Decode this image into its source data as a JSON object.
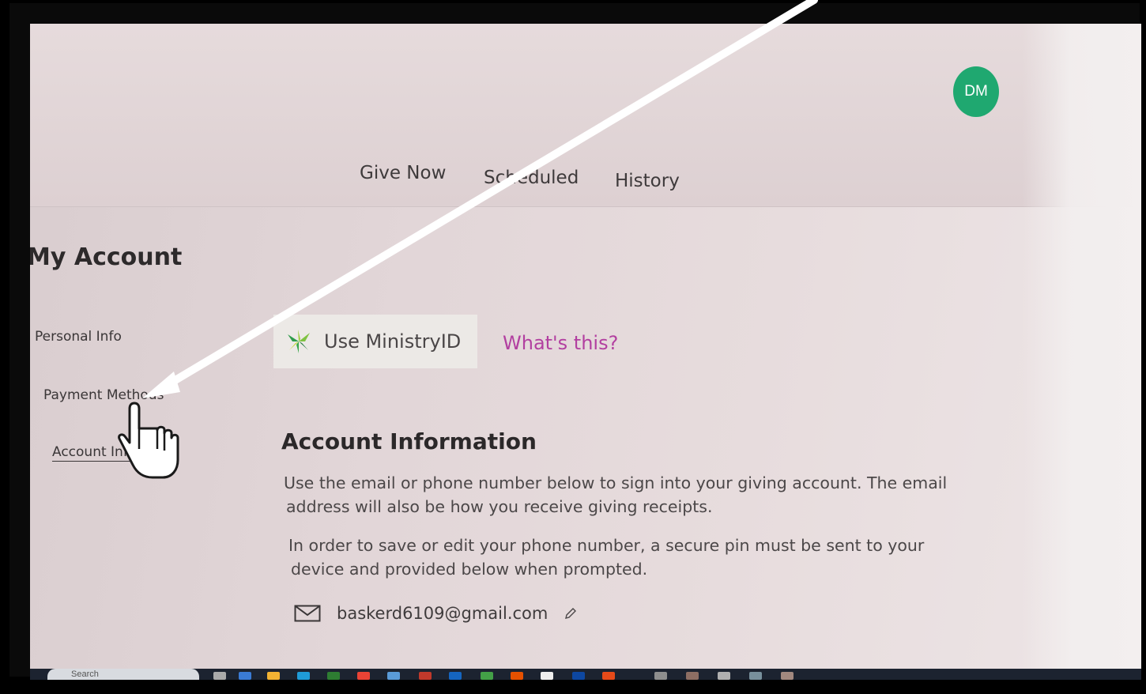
{
  "header": {
    "avatar_initials": "DM",
    "nav": [
      {
        "label": "Give Now"
      },
      {
        "label": "Scheduled"
      },
      {
        "label": "History"
      }
    ]
  },
  "sidebar": {
    "title": "My Account",
    "items": [
      {
        "label": "Personal Info"
      },
      {
        "label": "Payment Methods"
      },
      {
        "label": "Account Info"
      }
    ]
  },
  "main": {
    "ministry_button_label": "Use MinistryID",
    "whats_this": "What's this?",
    "section_title": "Account Information",
    "para1_line1": "Use the email or phone number below to sign into your giving account. The email",
    "para1_line2": "address will also be how you receive giving receipts.",
    "para2_line1": "In order to save or edit your phone number, a secure pin must be sent to your",
    "para2_line2": "device and provided below when prompted.",
    "email": "baskerd6109@gmail.com"
  },
  "taskbar": {
    "search_label": "Search"
  },
  "colors": {
    "avatar": "#1fa870",
    "link": "#b23fa0",
    "annotation_arrow": "#ffffff"
  }
}
